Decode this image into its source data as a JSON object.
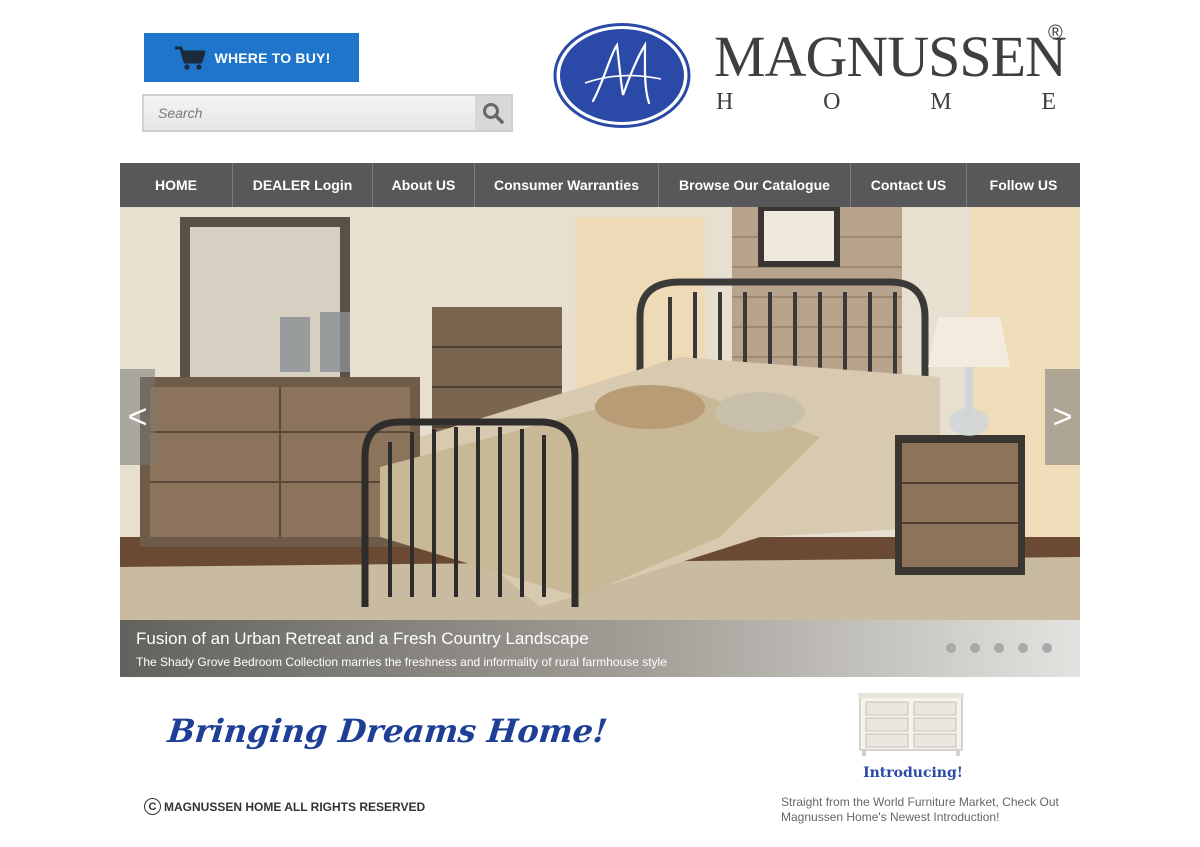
{
  "header": {
    "buy_button": {
      "label": "WHERE TO BUY!",
      "icon": "cart-icon",
      "color": "#1f75c9"
    },
    "search": {
      "placeholder": "Search",
      "value": "",
      "icon": "magnifier-icon"
    }
  },
  "brand": {
    "name": "MAGNUSSEN",
    "registered": "®",
    "subtitle_letters": [
      "H",
      "O",
      "M",
      "E"
    ],
    "monogram": "M",
    "color": "#2b4aa8"
  },
  "nav": {
    "items": [
      {
        "label": "HOME"
      },
      {
        "label": "DEALER Login"
      },
      {
        "label": "About US"
      },
      {
        "label": "Consumer Warranties"
      },
      {
        "label": "Browse Our Catalogue"
      },
      {
        "label": "Contact US"
      },
      {
        "label": "Follow US"
      }
    ]
  },
  "hero": {
    "prev_label": "<",
    "next_label": ">",
    "caption_title": "Fusion of an Urban Retreat and a Fresh Country Landscape",
    "caption_sub": "The Shady Grove Bedroom Collection marries the freshness and informality of rural farmhouse style",
    "slide_count": 5
  },
  "footer": {
    "tagline": "Bringing Dreams Home!",
    "copyright_symbol": "C",
    "copyright_text": "MAGNUSSEN HOME ALL RIGHTS RESERVED",
    "intro_title": "Introducing!",
    "intro_text": "Straight from the World Furniture Market, Check Out Magnussen Home's Newest Introduction!"
  }
}
